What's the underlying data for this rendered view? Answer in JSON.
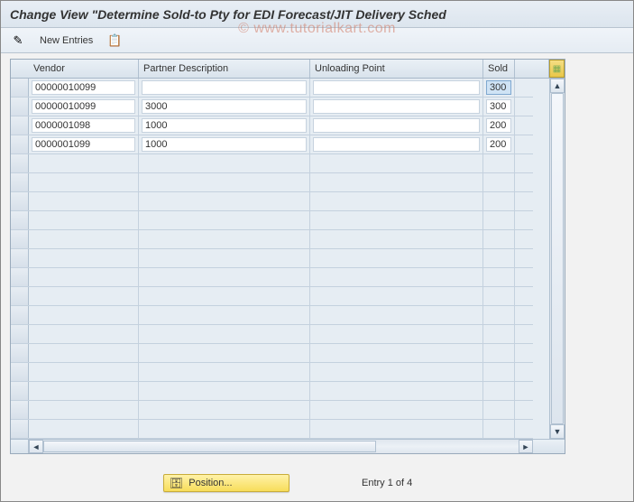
{
  "window": {
    "title": "Change View \"Determine Sold-to Pty for EDI Forecast/JIT Delivery Sched"
  },
  "watermark": "© www.tutorialkart.com",
  "toolbar": {
    "edit_icon": "✎",
    "new_entries_label": "New Entries",
    "copy_icon": "📋"
  },
  "table": {
    "columns": {
      "vendor": "Vendor",
      "partner_desc": "Partner Description",
      "unloading_point": "Unloading Point",
      "sold": "Sold"
    },
    "rows": [
      {
        "vendor": "00000010099",
        "partner_desc": "",
        "unloading_point": "",
        "sold": "300",
        "sold_selected": true
      },
      {
        "vendor": "00000010099",
        "partner_desc": "3000",
        "unloading_point": "",
        "sold": "300"
      },
      {
        "vendor": "0000001098",
        "partner_desc": "1000",
        "unloading_point": "",
        "sold": "200"
      },
      {
        "vendor": "0000001099",
        "partner_desc": "1000",
        "unloading_point": "",
        "sold": "200"
      }
    ],
    "empty_row_count": 15
  },
  "footer": {
    "position_label": "Position...",
    "entry_status": "Entry 1 of 4"
  }
}
